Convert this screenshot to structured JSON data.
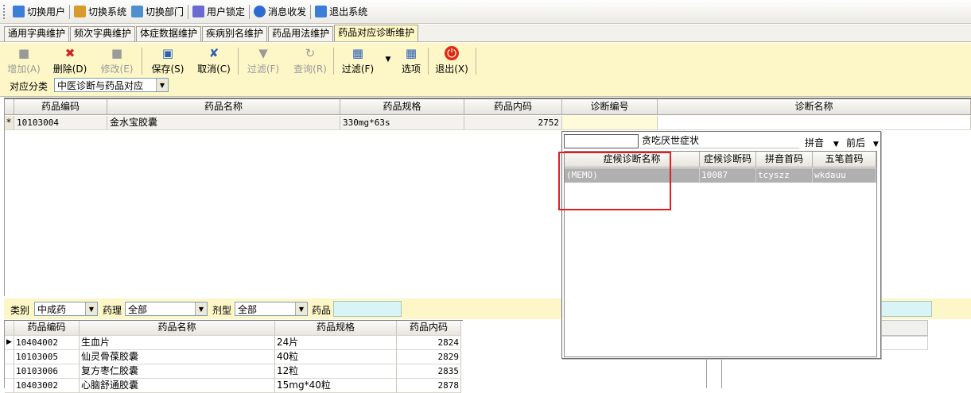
{
  "menubar": {
    "items": [
      {
        "label": "切换用户",
        "icon": "user-switch-icon",
        "color": "#3a7ed8"
      },
      {
        "label": "切换系统",
        "icon": "system-switch-icon",
        "color": "#d89a2a"
      },
      {
        "label": "切换部门",
        "icon": "department-icon",
        "color": "#4f8fd0"
      },
      {
        "label": "用户锁定",
        "icon": "user-lock-icon",
        "color": "#6a6ad0"
      },
      {
        "label": "消息收发",
        "icon": "info-icon",
        "color": "#2d6bd0"
      },
      {
        "label": "退出系统",
        "icon": "exit-icon",
        "color": "#3a7ed8"
      }
    ]
  },
  "tabs": [
    {
      "label": "通用字典维护"
    },
    {
      "label": "频次字典维护"
    },
    {
      "label": "体症数据维护"
    },
    {
      "label": "疾病别名维护"
    },
    {
      "label": "药品用法维护"
    },
    {
      "label": "药品对应诊断维护",
      "active": true
    }
  ],
  "toolbar": {
    "add": "增加(A)",
    "delete": "删除(D)",
    "edit": "修改(E)",
    "save": "保存(S)",
    "cancel": "取消(C)",
    "filter_disabled": "过滤(F)",
    "query": "查询(R)",
    "filter": "过滤(F)",
    "options": "选项",
    "exit": "退出(X)",
    "category_label": "对应分类",
    "category_value": "中医诊断与药品对应"
  },
  "main_grid": {
    "columns": [
      "药品编码",
      "药品名称",
      "药品规格",
      "药品内码",
      "诊断编号",
      "诊断名称"
    ],
    "row": {
      "marker": "*",
      "code": "10103004",
      "name": "金水宝胶囊",
      "spec": "330mg*63s",
      "internal": "2752",
      "diag_no": "",
      "diag_name": ""
    }
  },
  "filterbar": {
    "type_label": "类别",
    "type_value": "中成药",
    "pharm_label": "药理",
    "pharm_value": "全部",
    "form_label": "剂型",
    "form_value": "全部",
    "drug_label": "药品",
    "drug_value": ""
  },
  "bottom_grid": {
    "columns": [
      "药品编码",
      "药品名称",
      "药品规格",
      "药品内码"
    ],
    "rows": [
      {
        "code": "10404002",
        "name": "生血片",
        "spec": "24片",
        "internal": "2824"
      },
      {
        "code": "10103005",
        "name": "仙灵骨葆胶囊",
        "spec": "40粒",
        "internal": "2829"
      },
      {
        "code": "10103006",
        "name": "复方枣仁胶囊",
        "spec": "12粒",
        "internal": "2835"
      },
      {
        "code": "10403002",
        "name": "心脑舒通胶囊",
        "spec": "15mg*40粒",
        "internal": "2878"
      }
    ]
  },
  "popup": {
    "search_value": "",
    "hint": "贪吃厌世症状",
    "mode1": "拼音",
    "mode2": "前后",
    "columns": [
      "症候诊断名称",
      "症候诊断码",
      "拼音首码",
      "五笔首码"
    ],
    "row": {
      "name": "(MEMO)",
      "code": "10087",
      "pinyin": "tcyszz",
      "wubi": "wkdauu"
    }
  }
}
